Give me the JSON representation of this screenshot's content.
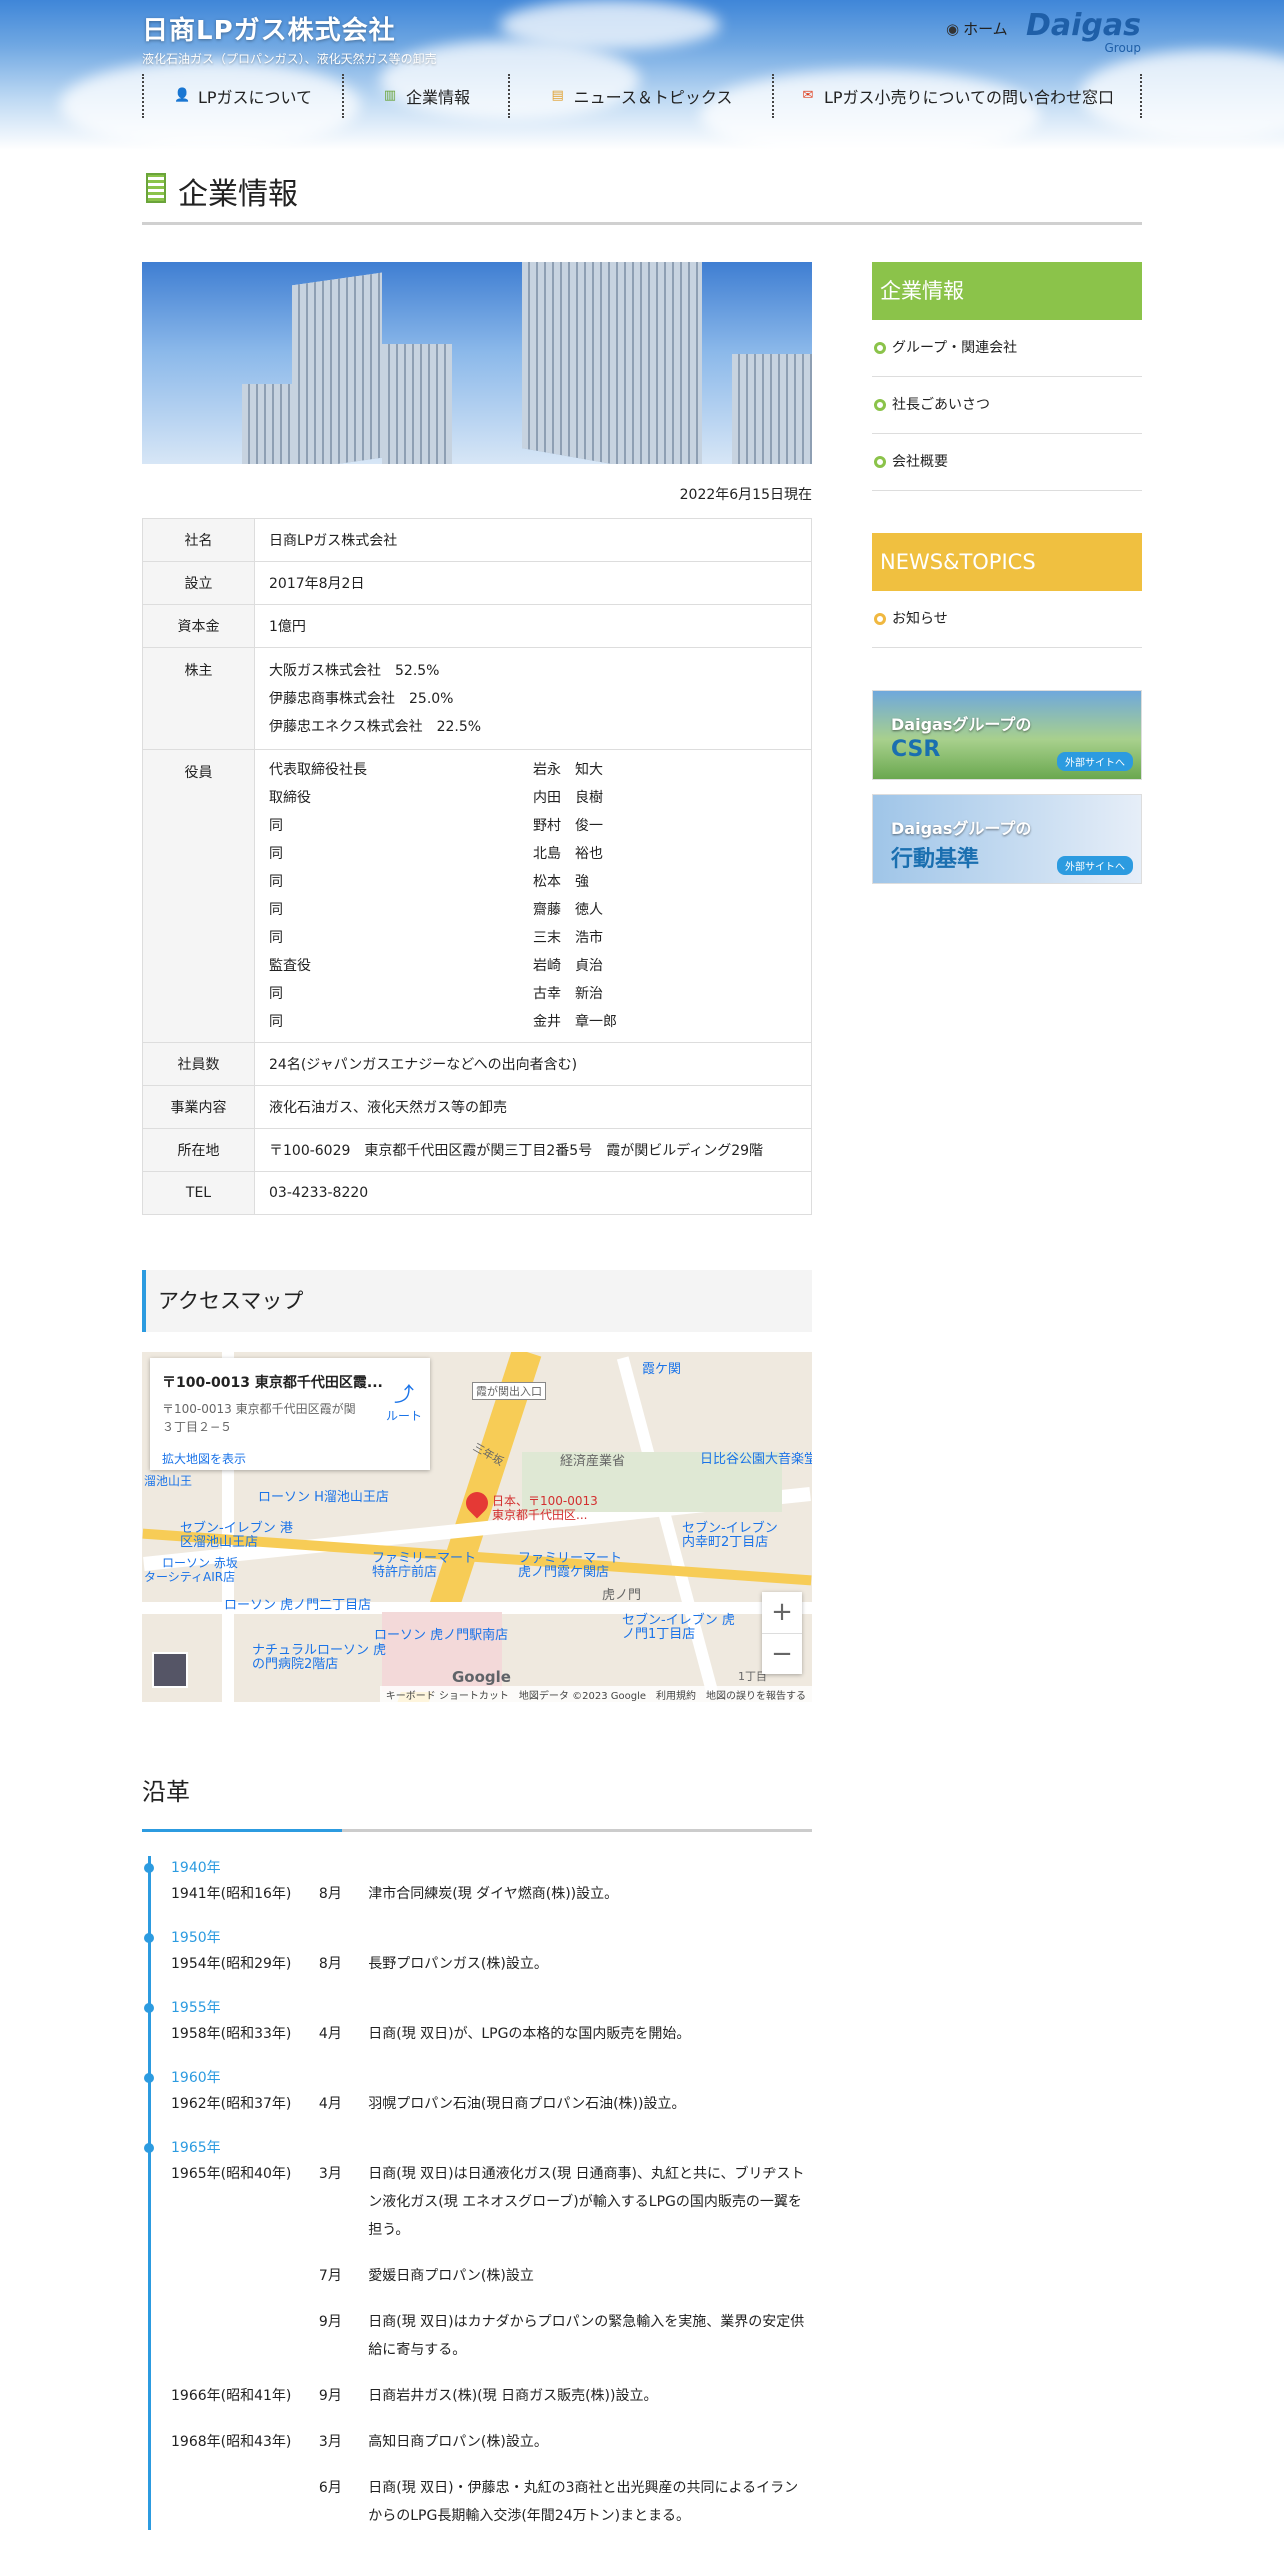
{
  "header": {
    "logo": "日商LPガス株式会社",
    "tagline": "液化石油ガス（プロパンガス）、液化天然ガス等の卸売",
    "home": "ホーム",
    "brand": "Daigas",
    "brand_sub": "Group"
  },
  "nav": [
    {
      "label": "LPガスについて",
      "icon": "person-icon"
    },
    {
      "label": "企業情報",
      "icon": "building-icon"
    },
    {
      "label": "ニュース＆トピックス",
      "icon": "news-icon"
    },
    {
      "label": "LPガス小売りについての問い合わせ窓口",
      "icon": "mail-icon"
    }
  ],
  "page_title": "企業情報",
  "as_of": "2022年6月15日現在",
  "info": {
    "company_k": "社名",
    "company_v": "日商LPガス株式会社",
    "founded_k": "設立",
    "founded_v": "2017年8月2日",
    "capital_k": "資本金",
    "capital_v": "1億円",
    "holders_k": "株主",
    "holders": [
      "大阪ガス株式会社　52.5%",
      "伊藤忠商事株式会社　25.0%",
      "伊藤忠エネクス株式会社　22.5%"
    ],
    "officers_k": "役員",
    "officers": [
      [
        "代表取締役社長",
        "岩永　知大"
      ],
      [
        "取締役",
        "内田　良樹"
      ],
      [
        "同",
        "野村　俊一"
      ],
      [
        "同",
        "北島　裕也"
      ],
      [
        "同",
        "松本　強"
      ],
      [
        "同",
        "齋藤　徳人"
      ],
      [
        "同",
        "三末　浩市"
      ],
      [
        "監査役",
        "岩崎　貞治"
      ],
      [
        "同",
        "古幸　新治"
      ],
      [
        "同",
        "金井　章一郎"
      ]
    ],
    "staff_k": "社員数",
    "staff_v": "24名(ジャパンガスエナジーなどへの出向者含む)",
    "business_k": "事業内容",
    "business_v": "液化石油ガス、液化天然ガス等の卸売",
    "address_k": "所在地",
    "address_v": "〒100-6029　東京都千代田区霞が関三丁目2番5号　霞が関ビルディング29階",
    "tel_k": "TEL",
    "tel_v": "03-4233-8220"
  },
  "access_title": "アクセスマップ",
  "map": {
    "card_title": "〒100-0013 東京都千代田区霞...",
    "card_addr": "〒100-0013 東京都千代田区霞が関３丁目２−５",
    "card_link": "拡大地図を表示",
    "route": "ルート",
    "marker": "日本、〒100-0013 東京都千代田区...",
    "google": "Google",
    "footer": "キーボード ショートカット　地図データ ©2023 Google　利用規約　地図の誤りを報告する",
    "pois": [
      "霞ケ関",
      "経済産業省",
      "日比谷公園大音楽堂",
      "ローソン H溜池山王店",
      "セブン-イレブン 港区溜池山王店",
      "ファミリーマート 特許庁前店",
      "ファミリーマート 虎ノ門霞ケ関店",
      "セブン-イレブン 内幸町2丁目店",
      "ローソン 虎ノ門二丁目店",
      "ローソン 虎ノ門駅南店",
      "セブン-イレブン 虎ノ門1丁目店",
      "ナチュラルローソン 虎の門病院2階店",
      "虎ノ門",
      "霞が関出入口",
      "三年坂",
      "1丁目",
      "溜池山王",
      "ターシティAIR店",
      "ローソン 赤坂"
    ]
  },
  "history": {
    "title": "沿革",
    "items": [
      {
        "decade": "1940年",
        "events": [
          {
            "y": "1941年(昭和16年)",
            "m": "8月",
            "d": "津市合同練炭(現 ダイヤ燃商(株))設立。"
          }
        ]
      },
      {
        "decade": "1950年",
        "events": [
          {
            "y": "1954年(昭和29年)",
            "m": "8月",
            "d": "長野プロパンガス(株)設立。"
          }
        ]
      },
      {
        "decade": "1955年",
        "events": [
          {
            "y": "1958年(昭和33年)",
            "m": "4月",
            "d": "日商(現 双日)が、LPGの本格的な国内販売を開始。"
          }
        ]
      },
      {
        "decade": "1960年",
        "events": [
          {
            "y": "1962年(昭和37年)",
            "m": "4月",
            "d": "羽幌プロパン石油(現日商プロパン石油(株))設立。"
          }
        ]
      },
      {
        "decade": "1965年",
        "events": [
          {
            "y": "1965年(昭和40年)",
            "m": "3月",
            "d": "日商(現 双日)は日通液化ガス(現 日通商事)、丸紅と共に、ブリヂストン液化ガス(現 エネオスグローブ)が輸入するLPGの国内販売の一翼を担う。"
          },
          {
            "y": "",
            "m": "7月",
            "d": "愛媛日商プロパン(株)設立"
          },
          {
            "y": "",
            "m": "9月",
            "d": "日商(現 双日)はカナダからプロパンの緊急輸入を実施、業界の安定供給に寄与する。"
          },
          {
            "y": "1966年(昭和41年)",
            "m": "9月",
            "d": "日商岩井ガス(株)(現 日商ガス販売(株))設立。"
          },
          {
            "y": "1968年(昭和43年)",
            "m": "3月",
            "d": "高知日商プロパン(株)設立。"
          },
          {
            "y": "",
            "m": "6月",
            "d": "日商(現 双日)・伊藤忠・丸紅の3商社と出光興産の共同によるイランからのLPG長期輸入交渉(年間24万トン)まとまる。"
          }
        ]
      }
    ]
  },
  "side": {
    "h1": "企業情報",
    "links1": [
      "グループ・関連会社",
      "社長ごあいさつ",
      "会社概要"
    ],
    "h2": "NEWS&TOPICS",
    "links2": [
      "お知らせ"
    ],
    "banner1": {
      "t1": "Daigasグループの",
      "t2": "CSR",
      "ext": "外部サイトへ"
    },
    "banner2": {
      "t1": "Daigasグループの",
      "t2": "行動基準",
      "ext": "外部サイトへ"
    },
    "colors": {
      "green": "#8bc34a",
      "yellow": "#f0c040",
      "blue": "#2c9be0"
    }
  }
}
